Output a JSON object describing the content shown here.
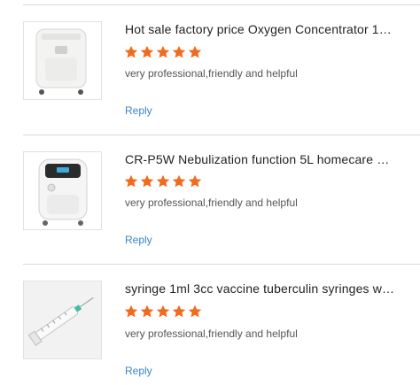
{
  "reviews": [
    {
      "product_title": "Hot sale factory price Oxygen Concentrator 10 ...",
      "rating": 5,
      "comment": "very professional,friendly and helpful",
      "reply_label": "Reply"
    },
    {
      "product_title": "CR-P5W Nebulization function 5L homecare m...",
      "rating": 5,
      "comment": "very professional,friendly and helpful",
      "reply_label": "Reply"
    },
    {
      "product_title": "syringe 1ml 3cc vaccine tuberculin syringes wi...",
      "rating": 5,
      "comment": "very professional,friendly and helpful",
      "reply_label": "Reply"
    }
  ],
  "colors": {
    "star": "#f26a1b",
    "reply_link": "#3a86c8",
    "divider": "#d9d9d9"
  }
}
